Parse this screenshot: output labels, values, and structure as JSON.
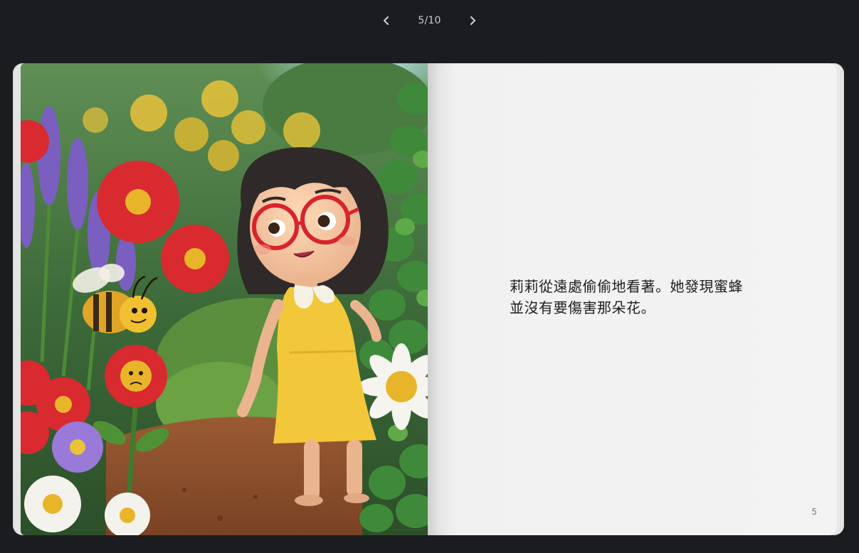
{
  "pager": {
    "prev_icon": "chevron-left-icon",
    "next_icon": "chevron-right-icon",
    "counter": "5/10"
  },
  "book": {
    "right_page": {
      "text": "莉莉從遠處偷偷地看著。她發現蜜蜂並沒有要傷害那朵花。",
      "page_number": "5"
    }
  },
  "colors": {
    "background": "#1b1c1f",
    "paper": "#f3f3f3",
    "dress": "#f2c83a",
    "glasses": "#d9232e"
  }
}
